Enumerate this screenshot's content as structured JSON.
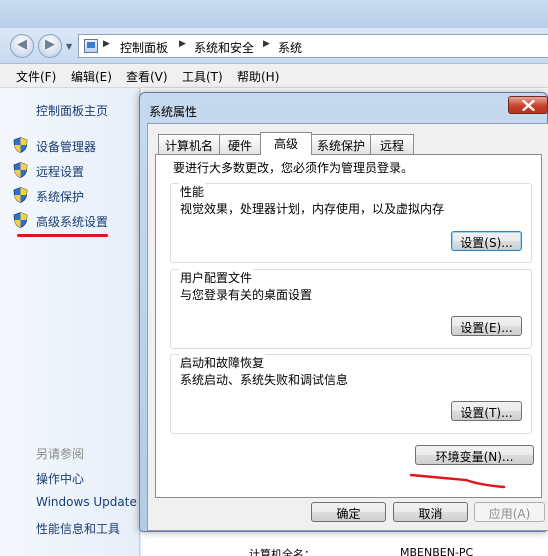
{
  "explorer": {
    "breadcrumb": [
      "控制面板",
      "系统和安全",
      "系统"
    ],
    "menu": [
      "文件(F)",
      "编辑(E)",
      "查看(V)",
      "工具(T)",
      "帮助(H)"
    ],
    "sidebar": {
      "home": "控制面板主页",
      "links": [
        "设备管理器",
        "远程设置",
        "系统保护",
        "高级系统设置"
      ],
      "see_also_label": "另请参阅",
      "see_also": [
        "操作中心",
        "Windows Update",
        "性能信息和工具"
      ]
    },
    "bottom_label": "计算机全名：",
    "bottom_value": "MBENBEN-PC"
  },
  "dialog": {
    "title": "系统属性",
    "tabs": [
      "计算机名",
      "硬件",
      "高级",
      "系统保护",
      "远程"
    ],
    "active_tab": "高级",
    "intro": "要进行大多数更改，您必须作为管理员登录。",
    "groups": [
      {
        "title": "性能",
        "desc": "视觉效果，处理器计划，内存使用，以及虚拟内存",
        "button": "设置(S)..."
      },
      {
        "title": "用户配置文件",
        "desc": "与您登录有关的桌面设置",
        "button": "设置(E)..."
      },
      {
        "title": "启动和故障恢复",
        "desc": "系统启动、系统失败和调试信息",
        "button": "设置(T)..."
      }
    ],
    "env_button": "环境变量(N)...",
    "ok": "确定",
    "cancel": "取消",
    "apply": "应用(A)"
  },
  "colors": {
    "annotation_red": "#e2131b",
    "link_blue": "#1b3c74"
  },
  "icons": [
    "back-arrow-icon",
    "forward-arrow-icon",
    "control-panel-icon",
    "uac-shield-icon",
    "close-icon"
  ]
}
